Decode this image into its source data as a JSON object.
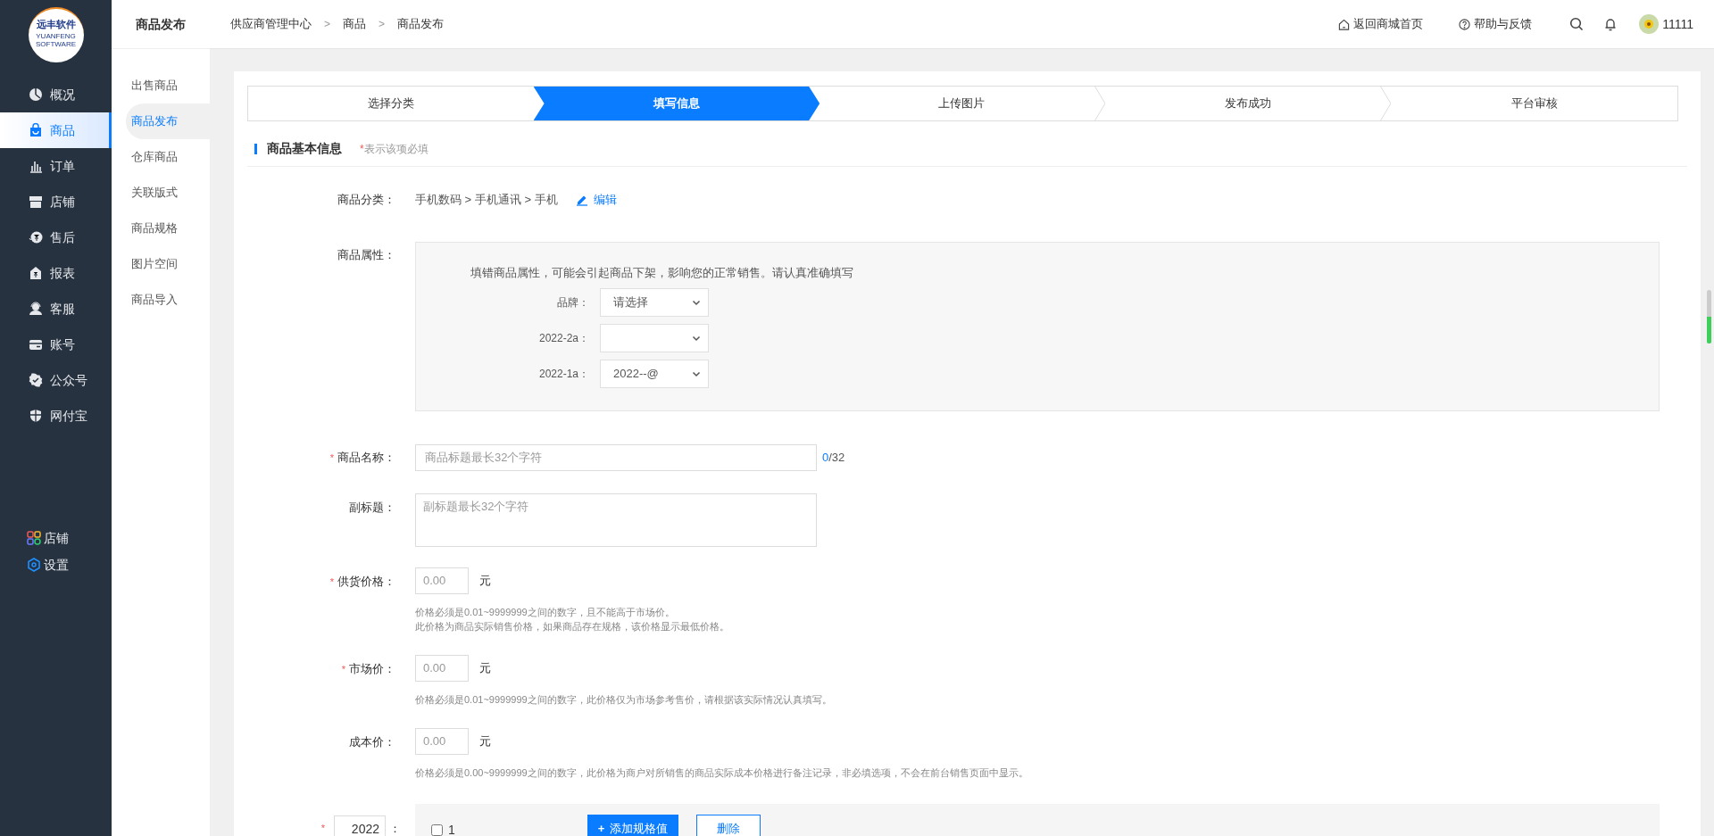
{
  "logo": {
    "text": "远丰软件",
    "subtext": "YUANFENG SOFTWARE"
  },
  "sidebar": {
    "items": [
      {
        "label": "概况",
        "selected": false
      },
      {
        "label": "商品",
        "selected": true
      },
      {
        "label": "订单",
        "selected": false
      },
      {
        "label": "店铺",
        "selected": false
      },
      {
        "label": "售后",
        "selected": false
      },
      {
        "label": "报表",
        "selected": false
      },
      {
        "label": "客服",
        "selected": false
      },
      {
        "label": "账号",
        "selected": false
      },
      {
        "label": "公众号",
        "selected": false
      },
      {
        "label": "网付宝",
        "selected": false
      }
    ],
    "bottom_items": [
      {
        "label": "店铺"
      },
      {
        "label": "设置"
      }
    ]
  },
  "subnav": {
    "title": "商品发布",
    "items": [
      {
        "label": "出售商品",
        "selected": false
      },
      {
        "label": "商品发布",
        "selected": true
      },
      {
        "label": "仓库商品",
        "selected": false
      },
      {
        "label": "关联版式",
        "selected": false
      },
      {
        "label": "商品规格",
        "selected": false
      },
      {
        "label": "图片空间",
        "selected": false
      },
      {
        "label": "商品导入",
        "selected": false
      }
    ]
  },
  "breadcrumb": [
    "供应商管理中心",
    "商品",
    "商品发布"
  ],
  "breadcrumb_separator": ">",
  "header_links": [
    {
      "label": "返回商城首页"
    },
    {
      "label": "帮助与反馈"
    }
  ],
  "user": {
    "name": "11111"
  },
  "steps": [
    {
      "label": "选择分类",
      "selected": false
    },
    {
      "label": "填写信息",
      "selected": true
    },
    {
      "label": "上传图片",
      "selected": false
    },
    {
      "label": "发布成功",
      "selected": false
    },
    {
      "label": "平台审核",
      "selected": false
    }
  ],
  "section": {
    "title": "商品基本信息",
    "note": "表示该项必填"
  },
  "required_mark": "*",
  "category": {
    "label": "商品分类：",
    "path": "手机数码 > 手机通讯 > 手机",
    "edit": "编辑"
  },
  "attributes": {
    "label": "商品属性：",
    "warning": "填错商品属性，可能会引起商品下架，影响您的正常销售。请认真准确填写",
    "selects": [
      {
        "label": "品牌：",
        "value": "请选择"
      },
      {
        "label": "2022-2a："
      },
      {
        "label": "2022-1a：",
        "value": "2022--@"
      }
    ]
  },
  "name_field": {
    "required": true,
    "label": "商品名称：",
    "placeholder": "商品标题最长32个字符",
    "count": "0",
    "max": "/32"
  },
  "subtitle_field": {
    "required": false,
    "label": "副标题：",
    "placeholder": "副标题最长32个字符"
  },
  "price_fields": [
    {
      "required": true,
      "label": "供货价格：",
      "placeholder": "0.00",
      "unit": "元",
      "help": [
        "价格必须是0.01~9999999之间的数字，且不能高于市场价。",
        "此价格为商品实际销售价格，如果商品存在规格，该价格显示最低价格。"
      ]
    },
    {
      "required": true,
      "label": "市场价：",
      "placeholder": "0.00",
      "unit": "元",
      "help": [
        "价格必须是0.01~9999999之间的数字，此价格仅为市场参考售价，请根据该实际情况认真填写。"
      ]
    },
    {
      "required": false,
      "label": "成本价：",
      "placeholder": "0.00",
      "unit": "元",
      "help": [
        "价格必须是0.00~9999999之间的数字，此价格为商户对所销售的商品实际成本价格进行备注记录，非必填选项，不会在前台销售页面中显示。"
      ]
    }
  ],
  "spec": {
    "required": true,
    "value": "2022",
    "colon": "：",
    "option": {
      "label": "1",
      "checked": false
    },
    "add_icon": "+",
    "add_button": "添加规格值",
    "delete_button": "删除"
  }
}
